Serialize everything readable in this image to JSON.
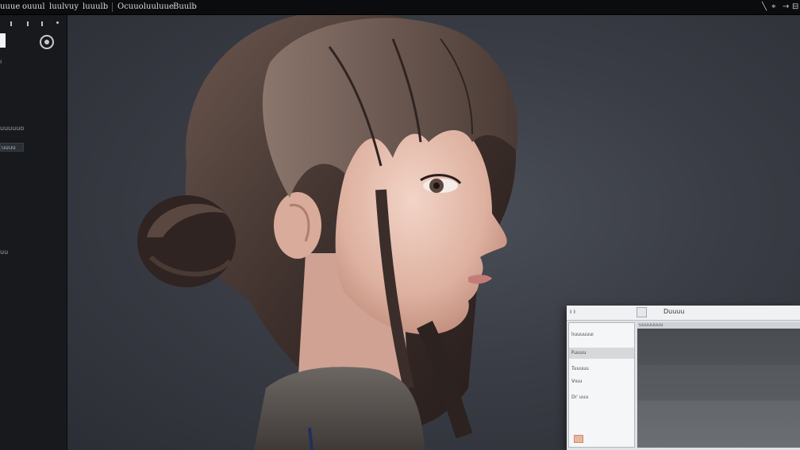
{
  "menubar": {
    "items": [
      "uuue",
      "ouuul",
      "luulvuy",
      "luuulb",
      "Ocuuol",
      "uuluue",
      "Buulb"
    ],
    "window_controls": [
      "╲",
      "⌖",
      "→",
      "⊟"
    ]
  },
  "left_panel": {
    "label_a": "ı",
    "label_b": "uuuuuo",
    "field_value": "uuuu",
    "label_c": "uu"
  },
  "dialog": {
    "title_left": "ı ı",
    "title_right": "Duuuu",
    "preview_header": "uuuuuuuu",
    "list_items": [
      {
        "label": "lıuuuuuuı",
        "selected": false
      },
      {
        "label": "Fuuuu",
        "selected": true
      },
      {
        "label": "Tuuuuu",
        "selected": false
      },
      {
        "label": "Vıuu",
        "selected": false
      },
      {
        "label": "Dı' uuu",
        "selected": false
      }
    ]
  },
  "colors": {
    "menubar_bg": "#0b0c0e",
    "panel_bg": "#17191d",
    "canvas_bg": "#3a3d45",
    "dialog_bg": "#dfe1e4",
    "accent_button": "#e9b79c"
  },
  "icons": {
    "dial": "radial-dial-icon",
    "swatch": "color-swatch-icon",
    "dialog_icon": "layer-icon"
  }
}
